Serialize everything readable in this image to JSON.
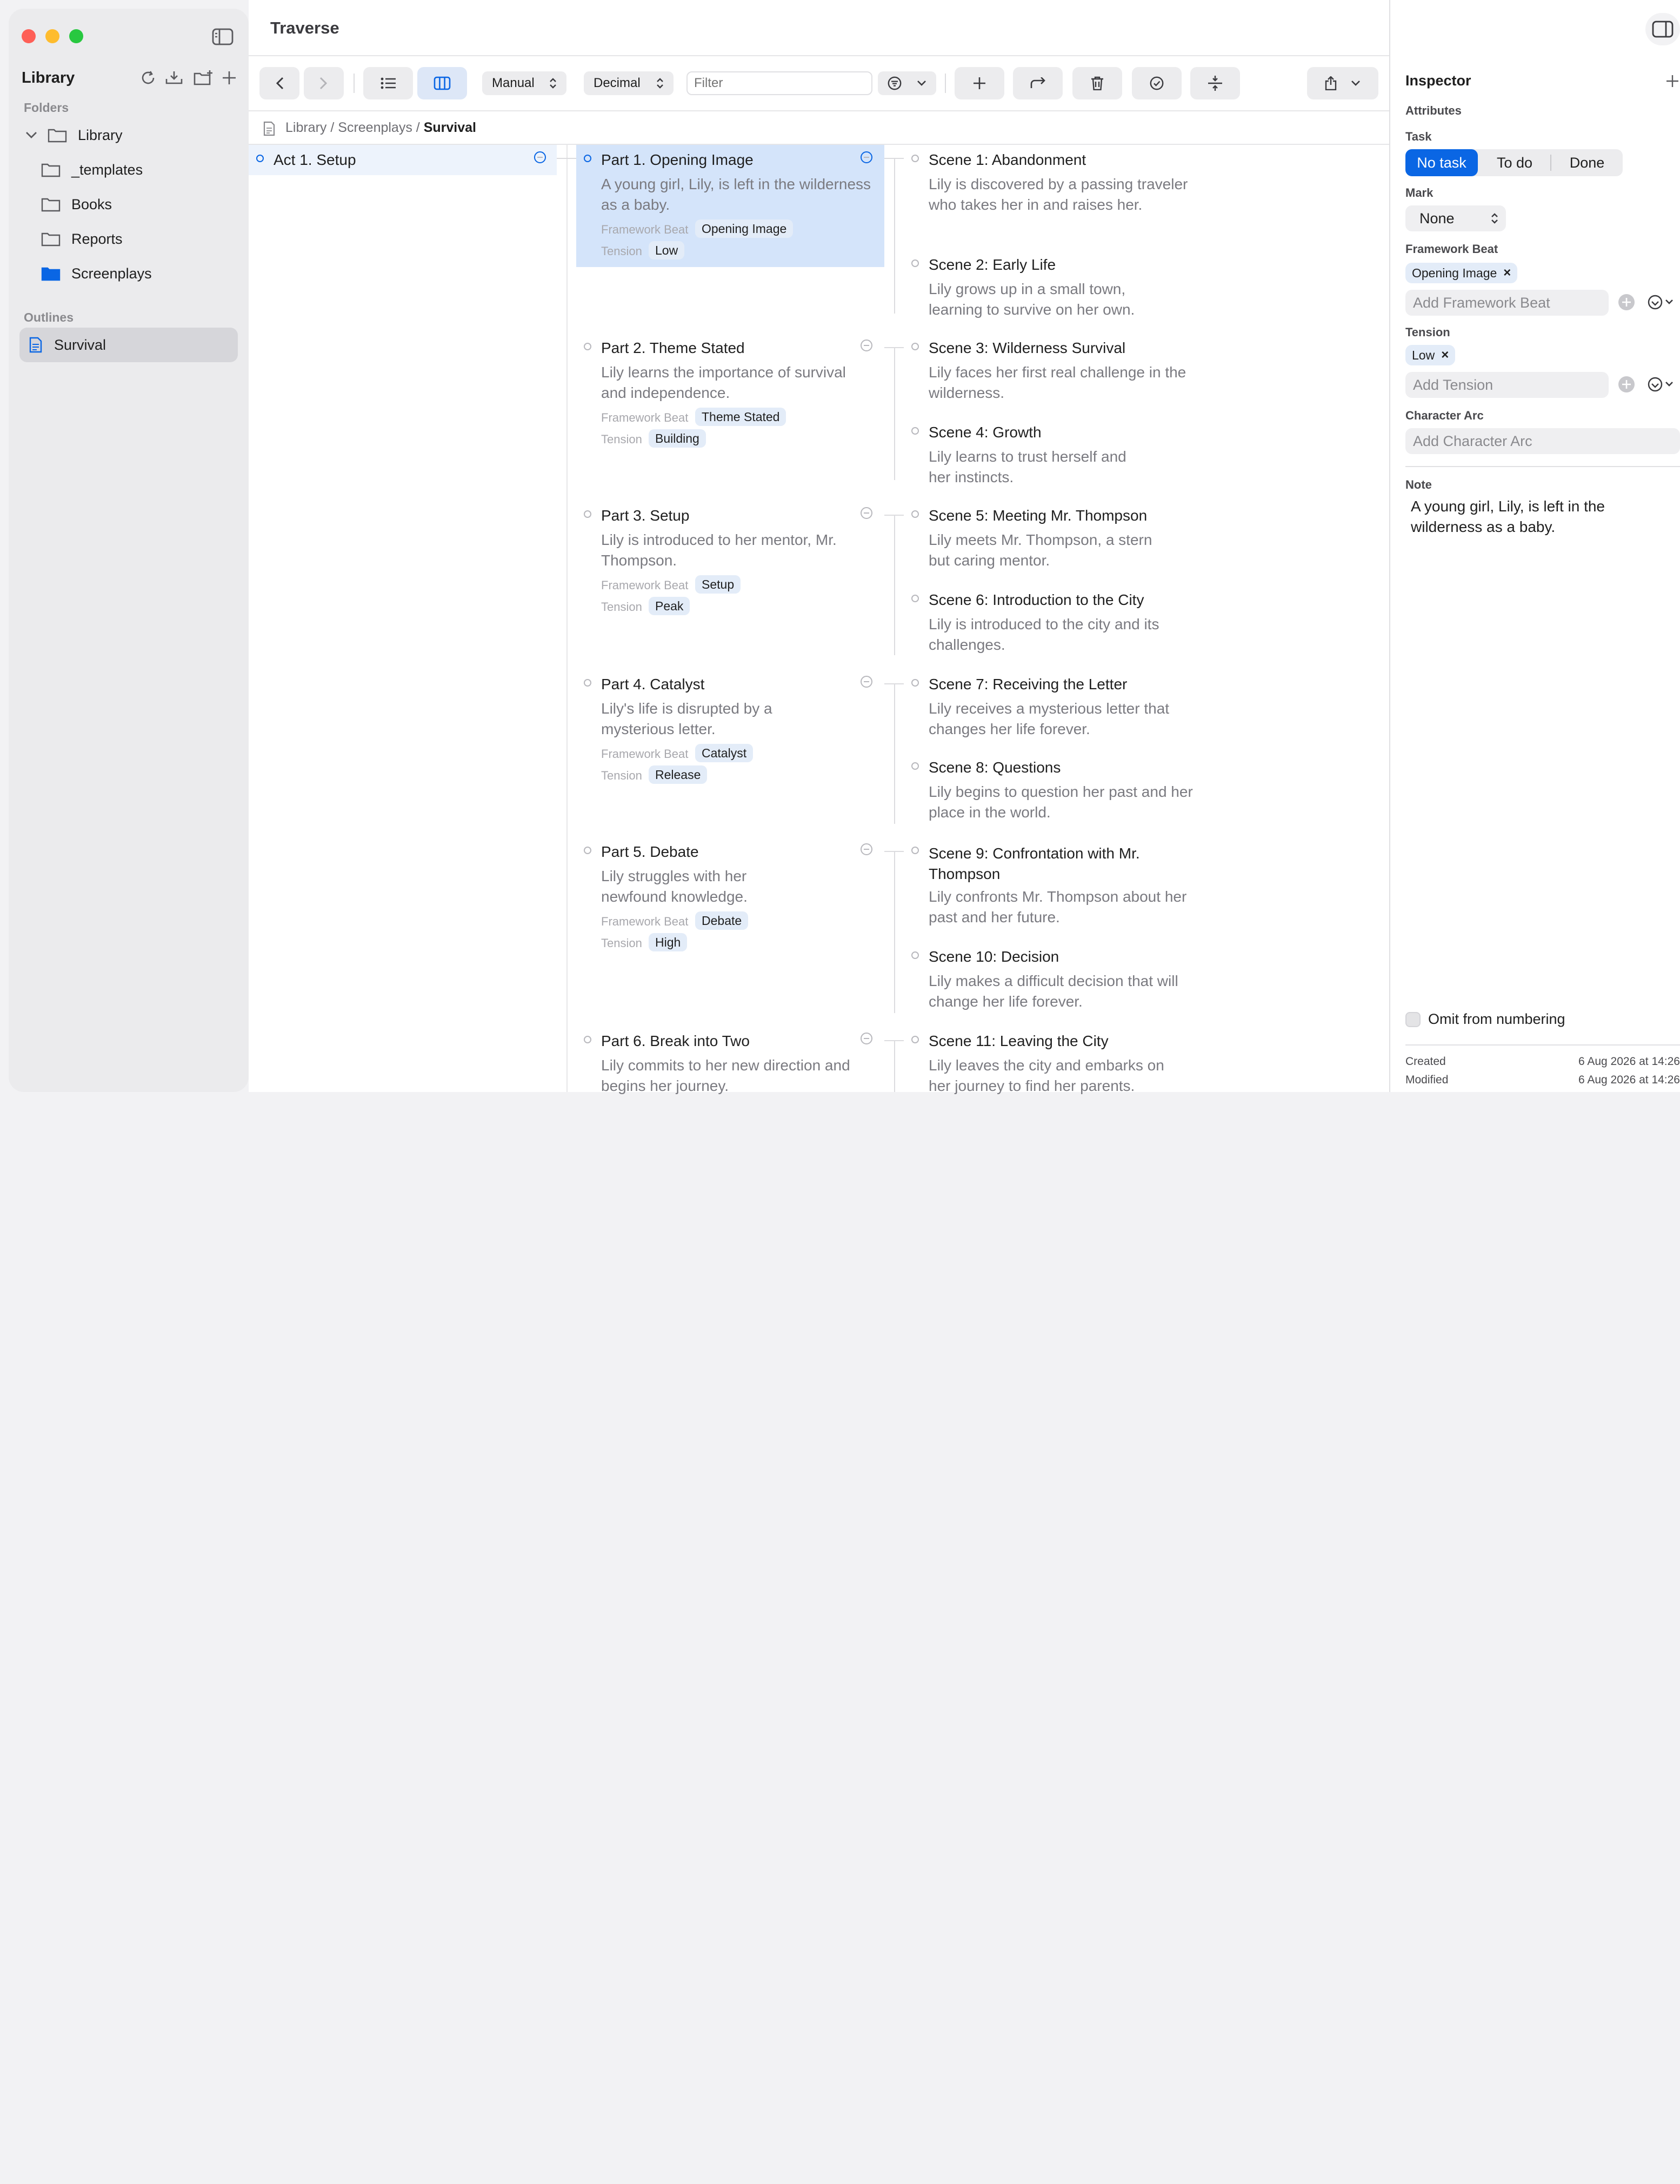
{
  "app": {
    "title": "Traverse"
  },
  "sidebar": {
    "title": "Library",
    "folders_label": "Folders",
    "outlines_label": "Outlines",
    "library_folder": "Library",
    "folders": [
      "_templates",
      "Books",
      "Reports",
      "Screenplays"
    ],
    "outlines": [
      "Survival"
    ]
  },
  "toolbar": {
    "sort_select": "Manual",
    "numbering_select": "Decimal",
    "filter_placeholder": "Filter"
  },
  "breadcrumb": {
    "parts": [
      "Library",
      "Screenplays"
    ],
    "current": "Survival",
    "sep": " / "
  },
  "column1": {
    "items": [
      {
        "title": "Act 1. Setup"
      }
    ]
  },
  "meta_labels": {
    "beat": "Framework Beat",
    "tension": "Tension"
  },
  "column2": {
    "items": [
      {
        "title": "Part 1. Opening Image",
        "desc": "A young girl, Lily, is left in the wilderness as a baby.",
        "beat": "Opening Image",
        "tension": "Low"
      },
      {
        "title": "Part 2. Theme Stated",
        "desc": "Lily learns the importance of survival and independence.",
        "beat": "Theme Stated",
        "tension": "Building"
      },
      {
        "title": "Part 3. Setup",
        "desc": "Lily is introduced to her mentor, Mr. Thompson.",
        "beat": "Setup",
        "tension": "Peak"
      },
      {
        "title": "Part 4. Catalyst",
        "desc": "Lily's life is disrupted by a mysterious letter.",
        "beat": "Catalyst",
        "tension": "Release"
      },
      {
        "title": "Part 5. Debate",
        "desc": "Lily struggles with her newfound knowledge.",
        "beat": "Debate",
        "tension": "High"
      },
      {
        "title": "Part 6. Break into Two",
        "desc": "Lily commits to her new direction and begins her journey."
      }
    ]
  },
  "column3": {
    "items": [
      {
        "title": "Scene 1: Abandonment",
        "desc": "Lily is discovered by a passing traveler who takes her in and raises her."
      },
      {
        "title": "Scene 2: Early Life",
        "desc": "Lily grows up in a small town, learning to survive on her own."
      },
      {
        "title": "Scene 3: Wilderness Survival",
        "desc": "Lily faces her first real challenge in the wilderness."
      },
      {
        "title": "Scene 4: Growth",
        "desc": "Lily learns to trust herself and her instincts."
      },
      {
        "title": "Scene 5: Meeting Mr. Thompson",
        "desc": "Lily meets Mr. Thompson, a stern but caring mentor."
      },
      {
        "title": "Scene 6: Introduction to the City",
        "desc": "Lily is introduced to the city and its challenges."
      },
      {
        "title": "Scene 7: Receiving the Letter",
        "desc": "Lily receives a mysterious letter that changes her life forever."
      },
      {
        "title": "Scene 8: Questions",
        "desc": "Lily begins to question her past and her place in the world."
      },
      {
        "title": "Scene 9: Confrontation with Mr. Thompson",
        "desc": "Lily confronts Mr. Thompson about her past and her future."
      },
      {
        "title": "Scene 10: Decision",
        "desc": "Lily makes a difficult decision that will change her life forever."
      },
      {
        "title": "Scene 11: Leaving the City",
        "desc": "Lily leaves the city and embarks on her journey to find her parents."
      }
    ]
  },
  "inspector": {
    "title": "Inspector",
    "attributes_label": "Attributes",
    "task_label": "Task",
    "task_options": [
      "No task",
      "To do",
      "Done"
    ],
    "mark_label": "Mark",
    "mark_value": "None",
    "framework_label": "Framework Beat",
    "framework_tag": "Opening Image",
    "framework_placeholder": "Add Framework Beat",
    "tension_label": "Tension",
    "tension_tag": "Low",
    "tension_placeholder": "Add Tension",
    "arc_label": "Character Arc",
    "arc_placeholder": "Add Character Arc",
    "note_label": "Note",
    "note_text": "A young girl, Lily, is left in the wilderness as a baby.",
    "omit_label": "Omit from numbering",
    "created_label": "Created",
    "created_value": "6 Aug 2026 at 14:26",
    "modified_label": "Modified",
    "modified_value": "6 Aug 2026 at 14:26"
  },
  "colors": {
    "accent": "#0a66e4",
    "selection": "#d4e4fa",
    "tag_bg": "#e3ecf8"
  }
}
